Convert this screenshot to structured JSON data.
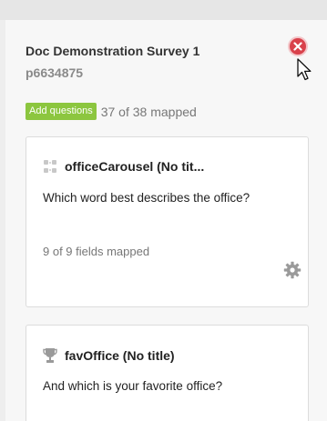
{
  "survey": {
    "title": "Doc Demonstration Survey 1",
    "id": "p6634875",
    "add_questions_label": "Add questions",
    "mapped_count": "37 of 38 mapped"
  },
  "questions": [
    {
      "name": "officeCarousel (No tit...",
      "text": "Which word best describes the office?",
      "fields_mapped": "9 of 9 fields mapped",
      "icon": "grid-icon"
    },
    {
      "name": "favOffice (No title)",
      "text": "And which is your favorite office?",
      "icon": "trophy-icon"
    }
  ],
  "colors": {
    "close": "#d9414b",
    "add_button": "#8cc63f"
  }
}
